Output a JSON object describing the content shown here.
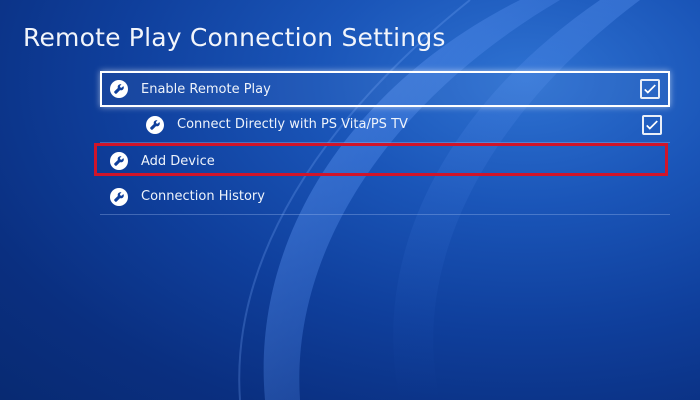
{
  "screen": {
    "title": "Remote Play Connection Settings"
  },
  "settings": {
    "items": [
      {
        "label": "Enable Remote Play",
        "icon": "wrench-icon",
        "checked": true,
        "focused": true
      },
      {
        "label": "Connect Directly with PS Vita/PS TV",
        "icon": "wrench-icon",
        "checked": true,
        "indented": true
      },
      {
        "label": "Add Device",
        "icon": "wrench-icon",
        "highlighted": true
      },
      {
        "label": "Connection History",
        "icon": "wrench-icon"
      }
    ]
  },
  "colors": {
    "background": "#0f3f9c",
    "highlight_outline": "#d0152a",
    "text": "#ffffff"
  }
}
